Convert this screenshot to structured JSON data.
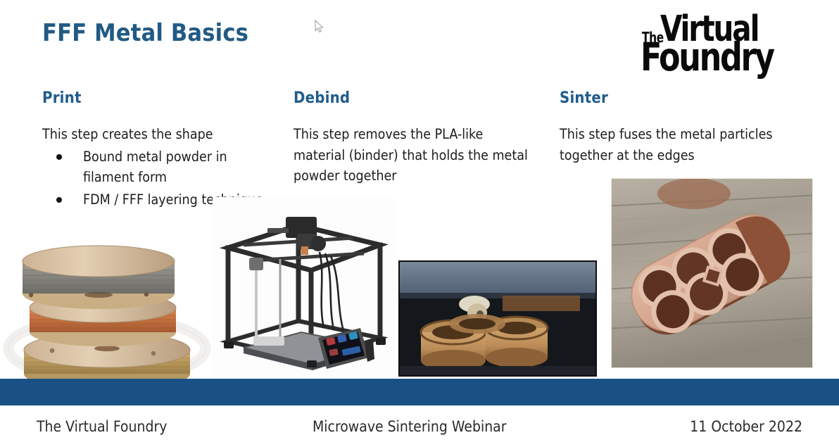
{
  "slide": {
    "title": "FFF Metal Basics",
    "logo": {
      "the": "The",
      "line1": "Virtual",
      "line2": "Foundry",
      "color": "#0a0a0a"
    },
    "columns": [
      {
        "heading": "Print",
        "body": "This step creates the shape",
        "bullets": [
          "Bound metal powder in filament form",
          "FDM / FFF layering technique"
        ],
        "image_caption": "three-stacked-filament-spools"
      },
      {
        "heading": "Debind",
        "body": "This step removes the PLA-like material (binder) that holds the metal powder together",
        "bullets": [],
        "image_caption": "fdm-3d-printer"
      },
      {
        "heading": "Sinter",
        "body": "This step fuses the metal particles together at the edges",
        "bullets": [],
        "image_caption": "sintered-copper-part-on-wood"
      }
    ],
    "extra_image_caption": "debinding-parts-in-furnace",
    "footer": {
      "left": "The Virtual Foundry",
      "center": "Microwave Sintering Webinar",
      "right": "11 October 2022"
    },
    "colors": {
      "title": "#215a84",
      "heading": "#1f5d8c",
      "band": "#1a5184",
      "body_text": "#1c1c1c"
    }
  }
}
